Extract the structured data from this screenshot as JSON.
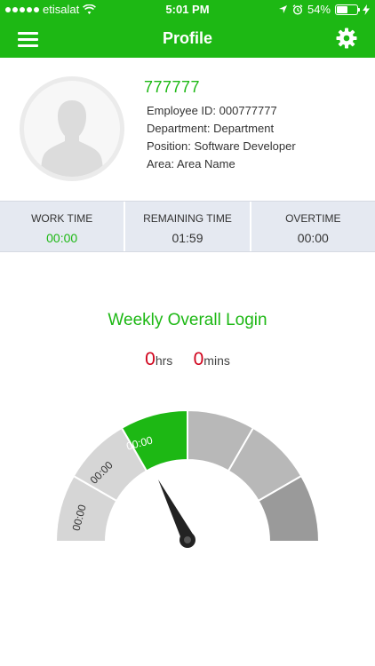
{
  "status_bar": {
    "carrier": "etisalat",
    "time": "5:01 PM",
    "battery": "54%",
    "battery_level": 0.54
  },
  "nav": {
    "title": "Profile"
  },
  "profile": {
    "employee_name": "777777",
    "employee_id": "Employee ID: 000777777",
    "department": "Department: Department",
    "position": "Position: Software Developer",
    "area": "Area: Area Name"
  },
  "stats": [
    {
      "label": "WORK TIME",
      "value": "00:00"
    },
    {
      "label": "REMAINING TIME",
      "value": "01:59"
    },
    {
      "label": "OVERTIME",
      "value": "00:00"
    }
  ],
  "weekly": {
    "title": "Weekly Overall Login",
    "hours_value": "0",
    "hours_unit": "hrs",
    "mins_value": "0",
    "mins_unit": "mins"
  },
  "gauge": {
    "segment_labels": [
      "00:00",
      "00:00",
      "00:00"
    ],
    "colors": {
      "accent": "#1db814",
      "light_gray": "#d6d6d6",
      "mid_gray": "#b8b8b8",
      "dark_gray": "#9a9a9a"
    }
  }
}
